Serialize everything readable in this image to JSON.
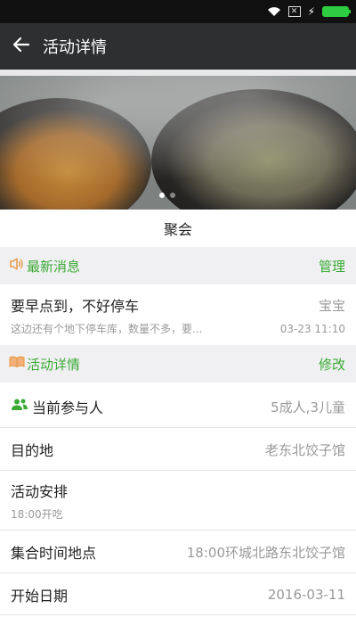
{
  "status_bar": {
    "icons": [
      "wifi-icon",
      "sim-x-icon",
      "charging-bolt-icon",
      "battery-icon"
    ],
    "sim_glyph": "✕",
    "battery_color": "#2ecc40"
  },
  "header": {
    "title": "活动详情",
    "back_icon": "arrow-left-icon",
    "background": "#2e2f31"
  },
  "hero": {
    "carousel_pages": 2,
    "active_page": 1
  },
  "event": {
    "name": "聚会"
  },
  "news_section": {
    "title": "最新消息",
    "icon": "speaker-icon",
    "action": "管理"
  },
  "message": {
    "title": "要早点到，不好停车",
    "author": "宝宝",
    "preview": "这边还有个地下停车库，数量不多，要...",
    "time": "03-23 11:10"
  },
  "details_section": {
    "title": "活动详情",
    "icon": "book-icon",
    "action": "修改"
  },
  "details": {
    "participants_label": "当前参与人",
    "participants_icon": "people-icon",
    "participants_value": "5成人,3儿童",
    "destination_label": "目的地",
    "destination_value": "老东北饺子馆",
    "schedule_label": "活动安排",
    "schedule_value": "18:00开吃",
    "meeting_label": "集合时间地点",
    "meeting_value": "18:00环城北路东北饺子馆",
    "start_label": "开始日期",
    "start_value": "2016-03-11"
  },
  "accent_color": "#3aaa35"
}
